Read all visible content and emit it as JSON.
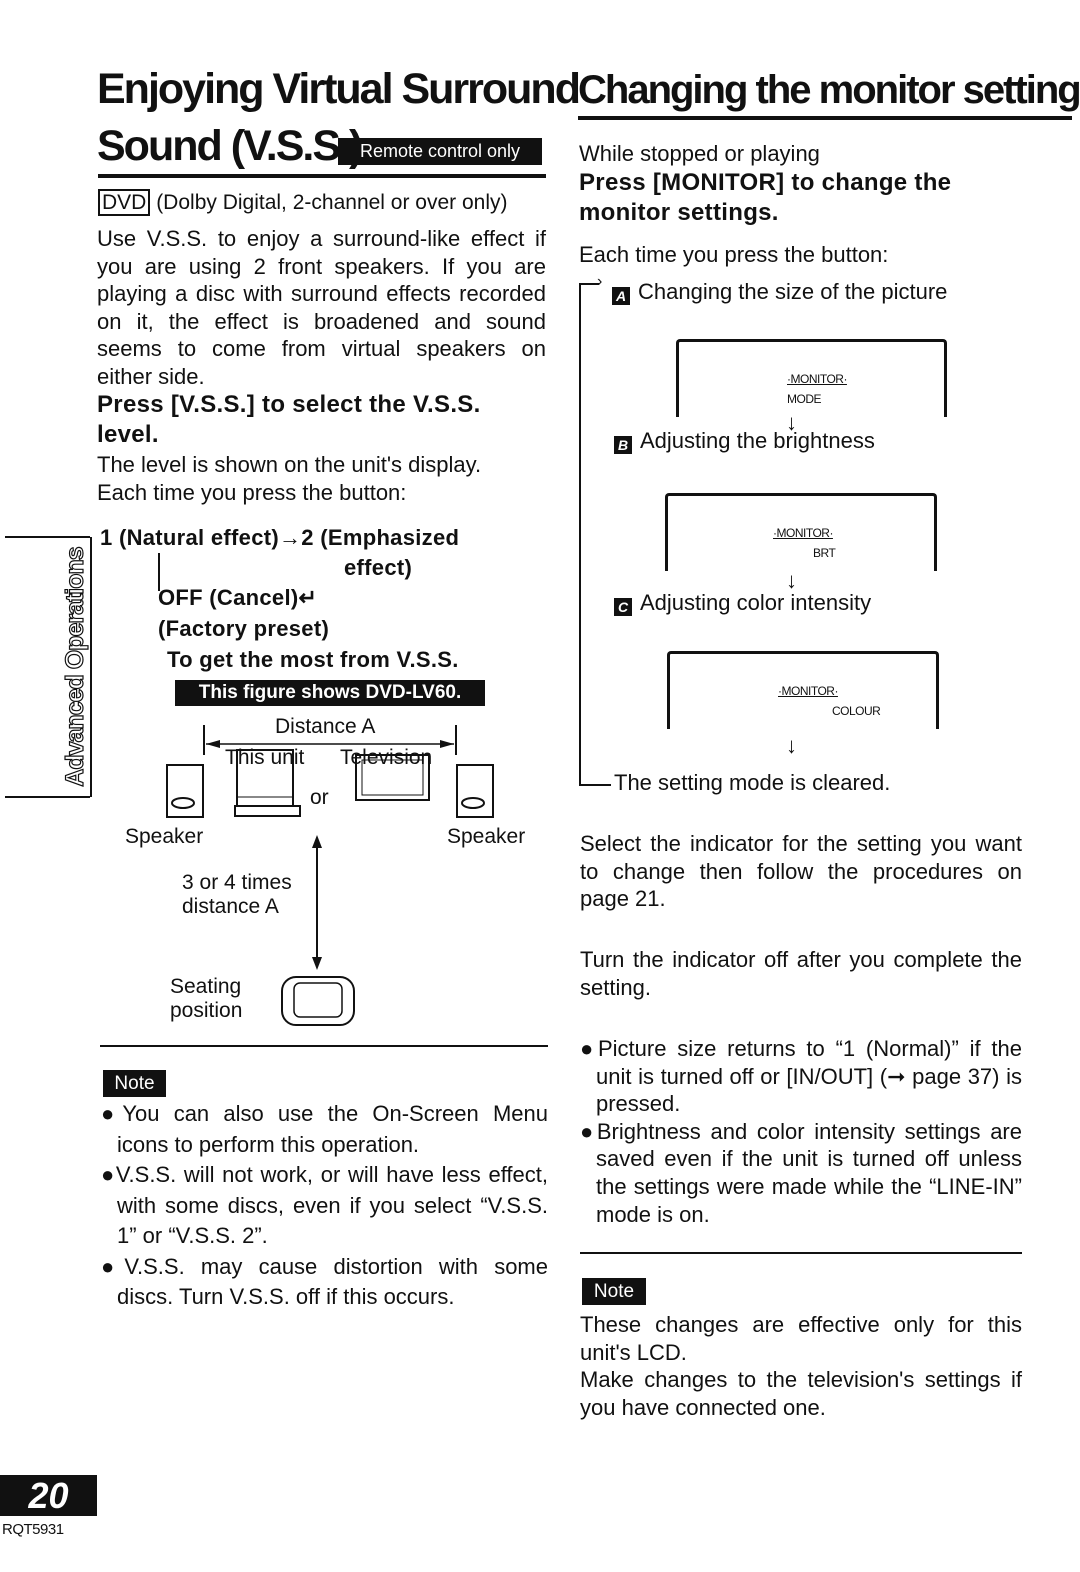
{
  "left": {
    "title_line1": "Enjoying Virtual Surround",
    "title_line2": "Sound (V.S.S.)",
    "remote_badge": "Remote control only",
    "dvd_tag": "DVD",
    "dvd_note": "(Dolby Digital, 2-channel or over only)",
    "intro": "Use V.S.S. to enjoy a surround-like effect if you are using 2 front speakers. If you are playing a disc with surround effects recorded on it, the effect is broadened and sound seems to come from virtual speakers on either side.",
    "step_heading": "Press [V.S.S.] to select the V.S.S. level.",
    "step_text1": "The level is shown on the unit's display.",
    "step_text2": "Each time you press the button:",
    "sequence": {
      "item1": "1 (Natural effect)→2 (Emphasized",
      "item1b": "effect)",
      "off": "OFF (Cancel)↵",
      "preset": "(Factory preset)"
    },
    "tip_heading": "To get the most from V.S.S.",
    "figure_badge": "This figure shows DVD-LV60.",
    "diagram": {
      "distance": "Distance A",
      "this_unit": "This unit",
      "television": "Television",
      "or": "or",
      "speaker_left": "Speaker",
      "speaker_right": "Speaker",
      "times_line1": "3 or 4 times",
      "times_line2": "distance A",
      "seating_line1": "Seating",
      "seating_line2": "position"
    },
    "note_badge": "Note",
    "notes": [
      "●You can also use the On-Screen Menu icons to perform this operation.",
      "●V.S.S. will not work, or will have less effect, with some discs, even if you select “V.S.S. 1” or “V.S.S. 2”.",
      "●V.S.S. may cause distortion with some discs. Turn V.S.S. off if this occurs."
    ]
  },
  "side_tab": "Advanced Operations",
  "right": {
    "title": "Changing the monitor settings",
    "condition": "While stopped or playing",
    "step_heading": "Press [MONITOR] to change the monitor settings.",
    "each_time": "Each time you press the button:",
    "flow": [
      {
        "letter": "A",
        "label": "Changing the size of the picture",
        "screen_title": "·MONITOR·",
        "screen_sub": "MODE"
      },
      {
        "letter": "B",
        "label": "Adjusting the brightness",
        "screen_title": "·MONITOR·",
        "screen_sub": "BRT"
      },
      {
        "letter": "C",
        "label": "Adjusting color intensity",
        "screen_title": "·MONITOR·",
        "screen_sub": "COLOUR"
      }
    ],
    "cleared": "The setting mode is cleared.",
    "select_text": "Select the indicator for the setting you want to change then follow the procedures on page 21.",
    "turn_off_text": "Turn the indicator off after you complete the setting.",
    "bullets": [
      "●Picture size returns to “1 (Normal)” if the unit is turned off or [IN/OUT] (➞ page 37) is pressed.",
      "●Brightness and color intensity settings are saved even if the unit is turned off unless the settings were made while the “LINE-IN” mode is on."
    ],
    "note_badge": "Note",
    "note_text1": "These changes are effective only for this unit's LCD.",
    "note_text2": "Make changes to the television's settings if you have connected one."
  },
  "footer": {
    "page_number": "20",
    "code": "RQT5931"
  }
}
